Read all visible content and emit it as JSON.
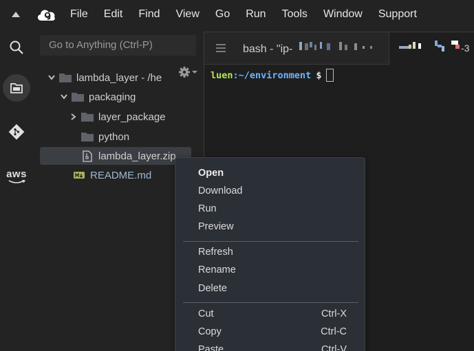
{
  "menubar": {
    "items": [
      "File",
      "Edit",
      "Find",
      "View",
      "Go",
      "Run",
      "Tools",
      "Window",
      "Support"
    ]
  },
  "activity_bar": {
    "aws_label": "aws"
  },
  "sidebar": {
    "goto_placeholder": "Go to Anything (Ctrl-P)",
    "tree": [
      {
        "label": "lambda_layer - /hе",
        "type": "folder",
        "expanded": true
      },
      {
        "label": "packaging",
        "type": "folder",
        "expanded": true
      },
      {
        "label": "layer_package",
        "type": "folder",
        "expanded": false
      },
      {
        "label": "python",
        "type": "folder"
      },
      {
        "label": "lambda_layer.zip",
        "type": "zip",
        "selected": true
      },
      {
        "label": "README.md",
        "type": "markdown"
      }
    ]
  },
  "terminal": {
    "tab_title": "bash - \"ip-",
    "tab_suffix": "-3",
    "prompt_user": "luen",
    "prompt_path": ":~/environment",
    "prompt_symbol": "$"
  },
  "context_menu": {
    "groups": [
      [
        {
          "label": "Open",
          "bold": true
        },
        {
          "label": "Download"
        },
        {
          "label": "Run"
        },
        {
          "label": "Preview"
        }
      ],
      [
        {
          "label": "Refresh"
        },
        {
          "label": "Rename"
        },
        {
          "label": "Delete"
        }
      ],
      [
        {
          "label": "Cut",
          "shortcut": "Ctrl-X"
        },
        {
          "label": "Copy",
          "shortcut": "Ctrl-C"
        },
        {
          "label": "Paste",
          "shortcut": "Ctrl-V"
        }
      ]
    ]
  },
  "colors": {
    "background": "#232323",
    "terminal_bg": "#1e1e1e",
    "prompt_user": "#b5e853",
    "prompt_path": "#6cb6ff",
    "selection": "#3b3e43",
    "menu_bg": "#2b2f36"
  }
}
